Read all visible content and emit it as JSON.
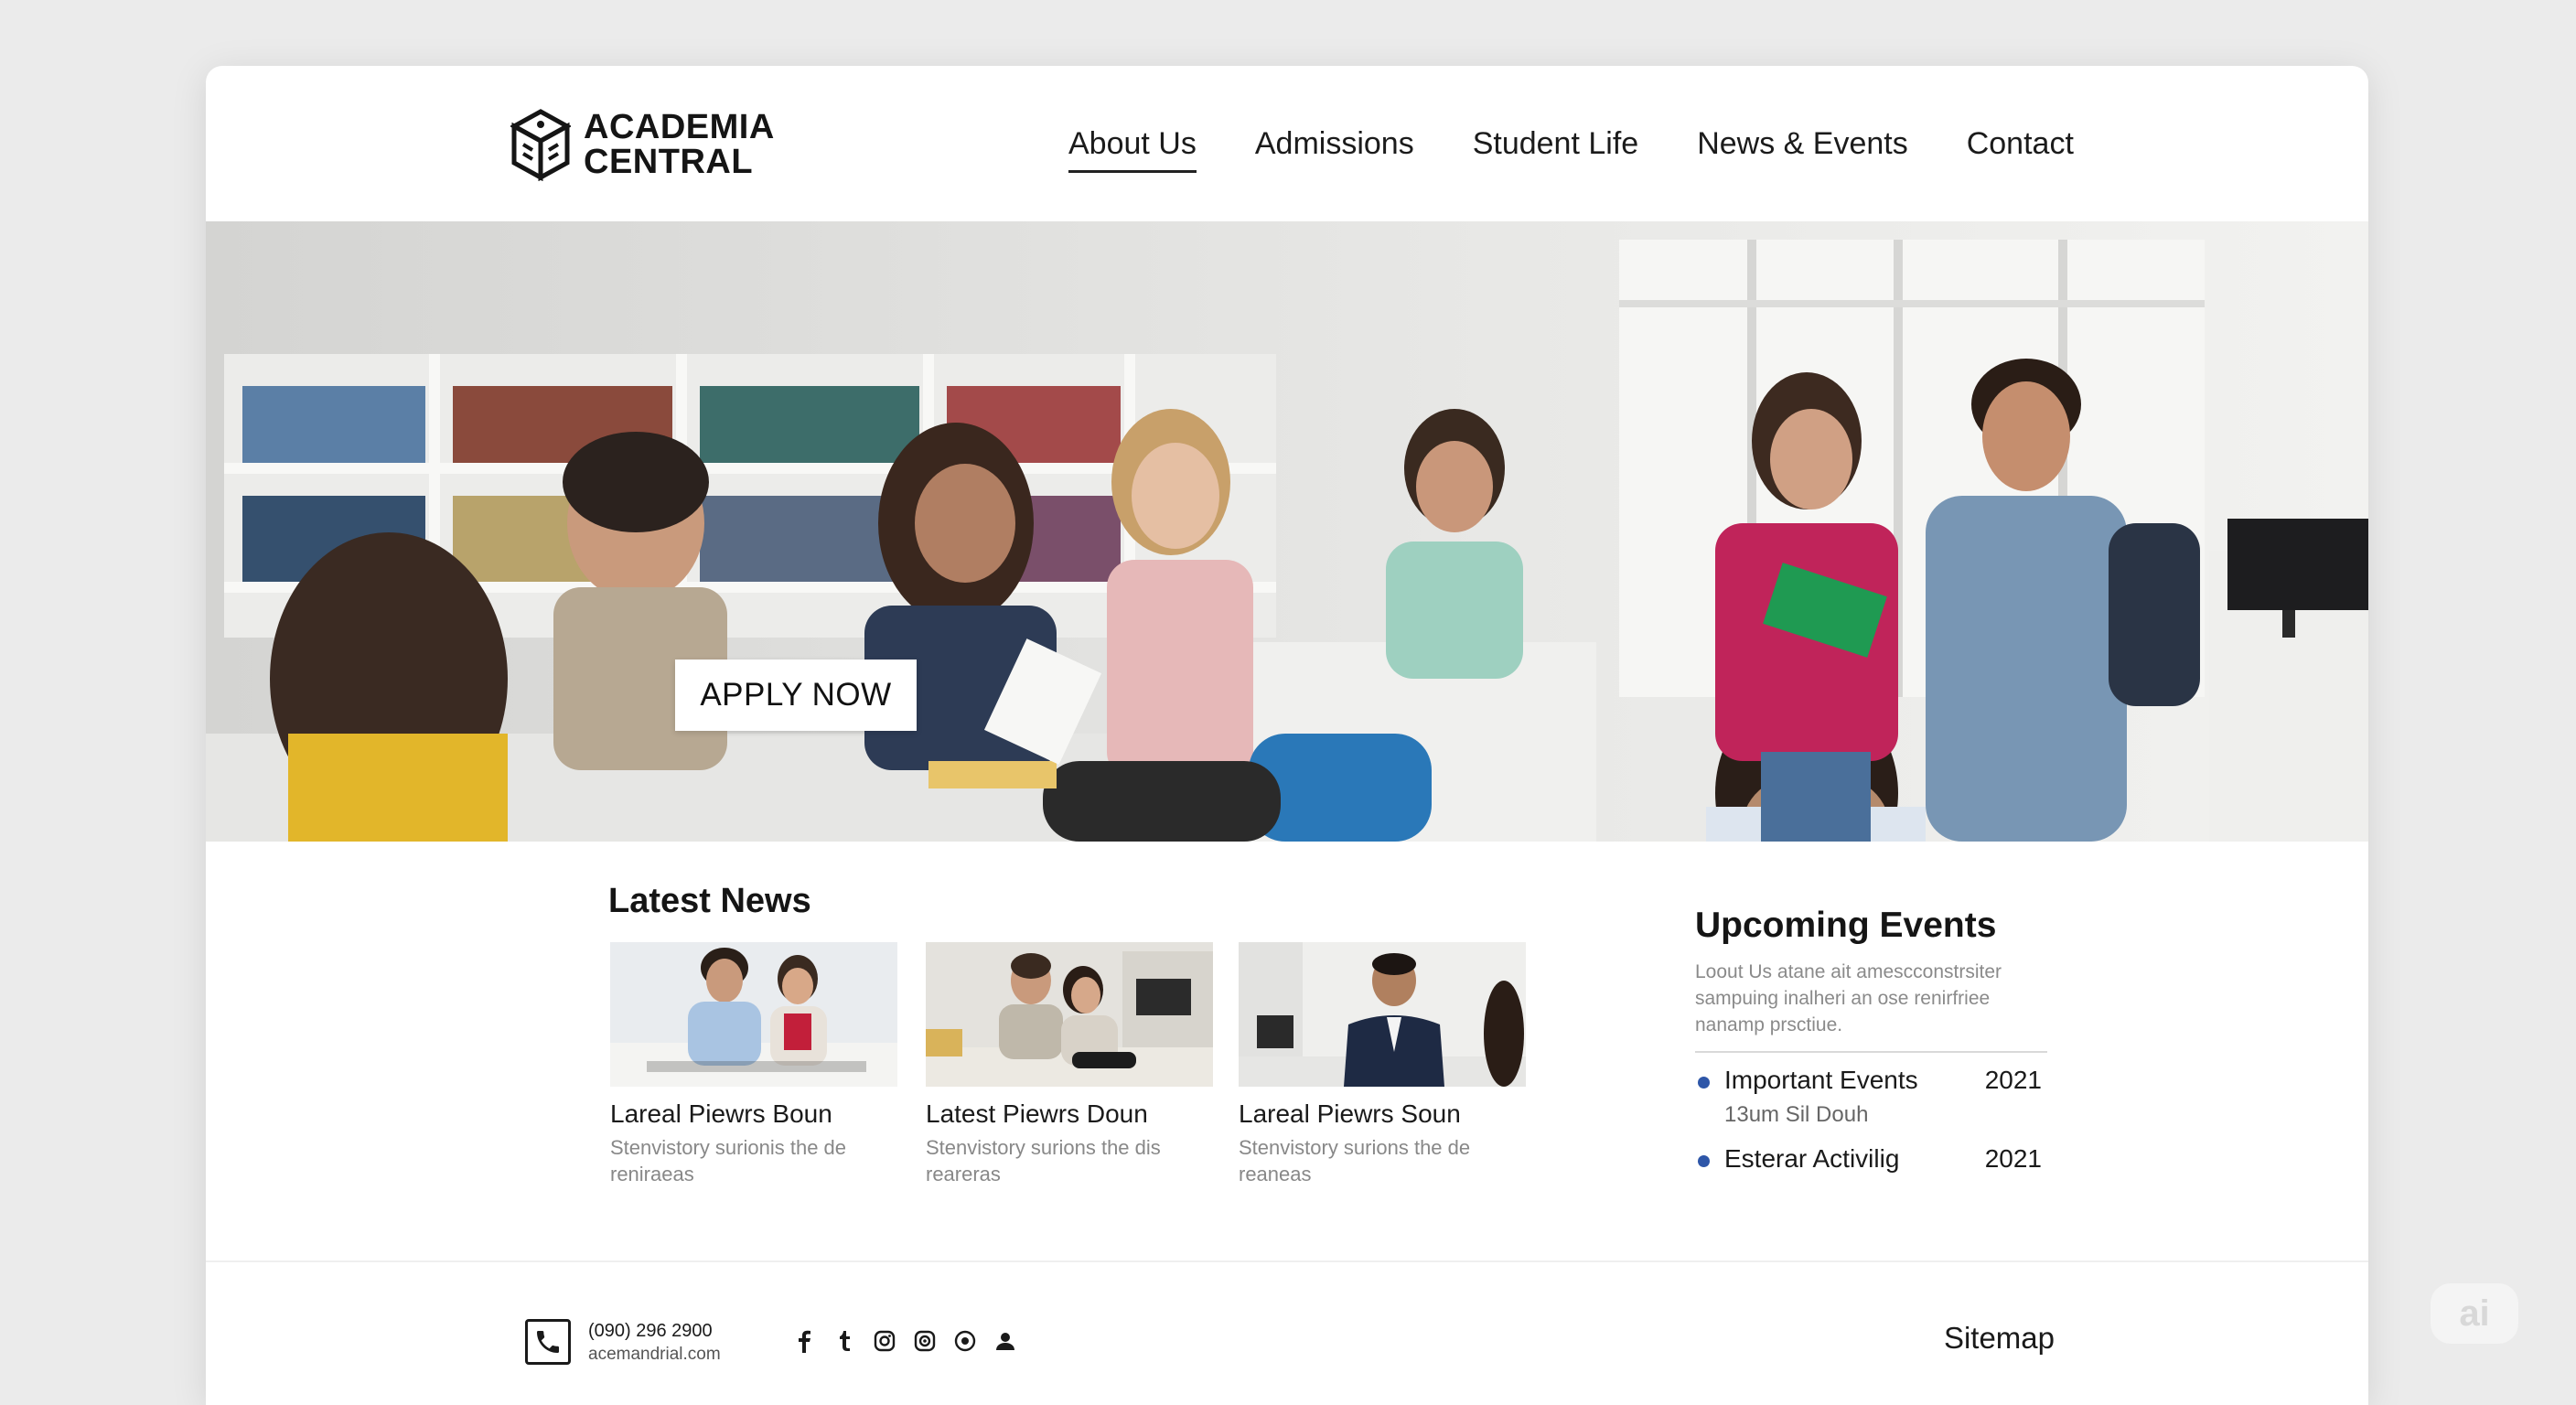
{
  "brand": {
    "line1": "ACADEMIA",
    "line2": "CENTRAL"
  },
  "nav": [
    {
      "label": "About Us",
      "active": true
    },
    {
      "label": "Admissions"
    },
    {
      "label": "Student Life"
    },
    {
      "label": "News & Events"
    },
    {
      "label": "Contact"
    }
  ],
  "hero": {
    "cta_label": "APPLY NOW"
  },
  "latest_news": {
    "title": "Latest News",
    "items": [
      {
        "headline": "Lareal Piewrs Boun",
        "desc": "Stenvistory surionis the de reniraeas"
      },
      {
        "headline": "Latest Piewrs Doun",
        "desc": "Stenvistory surions the dis reareras"
      },
      {
        "headline": "Lareal Piewrs Soun",
        "desc": "Stenvistory surions the de reaneas"
      }
    ]
  },
  "events": {
    "title": "Upcoming Events",
    "desc": "Loout Us atane ait amescconstrsiter sampuing inalheri an ose renirfriee nanamp prsctiue.",
    "items": [
      {
        "name": "Important Events",
        "year": "2021",
        "sub": "13um Sil Douh"
      },
      {
        "name": "Esterar Activilig",
        "year": "2021"
      }
    ]
  },
  "footer": {
    "phone": "(090) 296 2900",
    "email": "acemandrial.com",
    "social_icons": [
      "facebook-icon",
      "tumblr-icon",
      "instagram-icon",
      "camera-icon",
      "target-icon",
      "user-icon"
    ],
    "sitemap_label": "Sitemap"
  },
  "watermark": "ai",
  "colors": {
    "accent_dot": "#2e56a8",
    "page_bg": "#ebebeb",
    "card_bg": "#ffffff"
  }
}
